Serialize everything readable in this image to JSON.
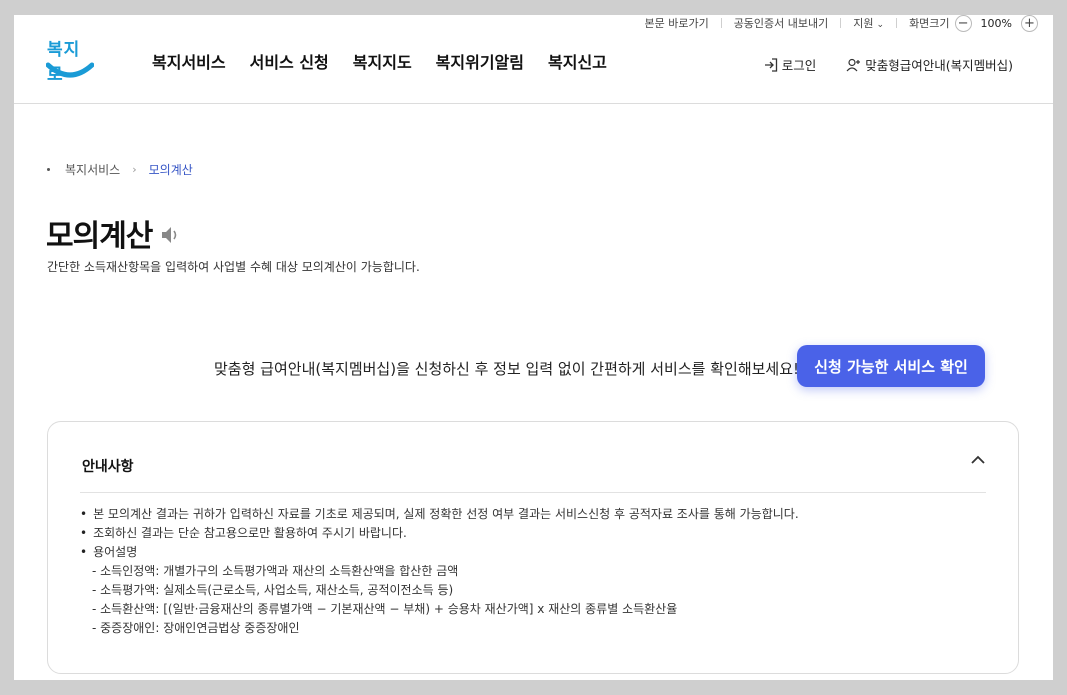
{
  "util": {
    "skip": "본문 바로가기",
    "cert": "공동인증서 내보내기",
    "support": "지원",
    "zoom_label": "화면크기",
    "zoom_value": "100%",
    "zoom_minus": "−",
    "zoom_plus": "+"
  },
  "logo": {
    "text": "복지로"
  },
  "gnb": [
    {
      "label": "복지서비스"
    },
    {
      "label": "서비스 신청"
    },
    {
      "label": "복지지도"
    },
    {
      "label": "복지위기알림"
    },
    {
      "label": "복지신고"
    }
  ],
  "header_right": {
    "login": "로그인",
    "membership": "맞춤형급여안내(복지멤버십)"
  },
  "breadcrumb": {
    "parent": "복지서비스",
    "current": "모의계산"
  },
  "page": {
    "title": "모의계산",
    "subtitle": "간단한 소득재산항목을 입력하여 사업별 수혜 대상 모의계산이 가능합니다."
  },
  "promo": {
    "text": "맞춤형 급여안내(복지멤버십)을 신청하신 후 정보 입력 없이 간편하게 서비스를 확인해보세요!",
    "button": "신청 가능한 서비스 확인"
  },
  "notice": {
    "title": "안내사항",
    "items": [
      "본 모의계산 결과는 귀하가 입력하신 자료를 기초로 제공되며, 실제 정확한 선정 여부 결과는 서비스신청 후 공적자료 조사를 통해 가능합니다.",
      "조회하신 결과는 단순 참고용으로만 활용하여 주시기 바랍니다.",
      "용어설명"
    ],
    "terms": [
      "- 소득인정액: 개별가구의 소득평가액과 재산의 소득환산액을 합산한 금액",
      "- 소득평가액: 실제소득(근로소득, 사업소득, 재산소득, 공적이전소득 등)",
      "- 소득환산액: [(일반·금융재산의 종류별가액 − 기본재산액 − 부채) + 승용차 재산가액] x 재산의 종류별 소득환산율",
      "- 중증장애인: 장애인연금법상 중증장애인"
    ]
  },
  "colors": {
    "accent": "#4a62e8",
    "breadcrumb_current": "#3756c6",
    "logo": "#1a9bd6"
  }
}
